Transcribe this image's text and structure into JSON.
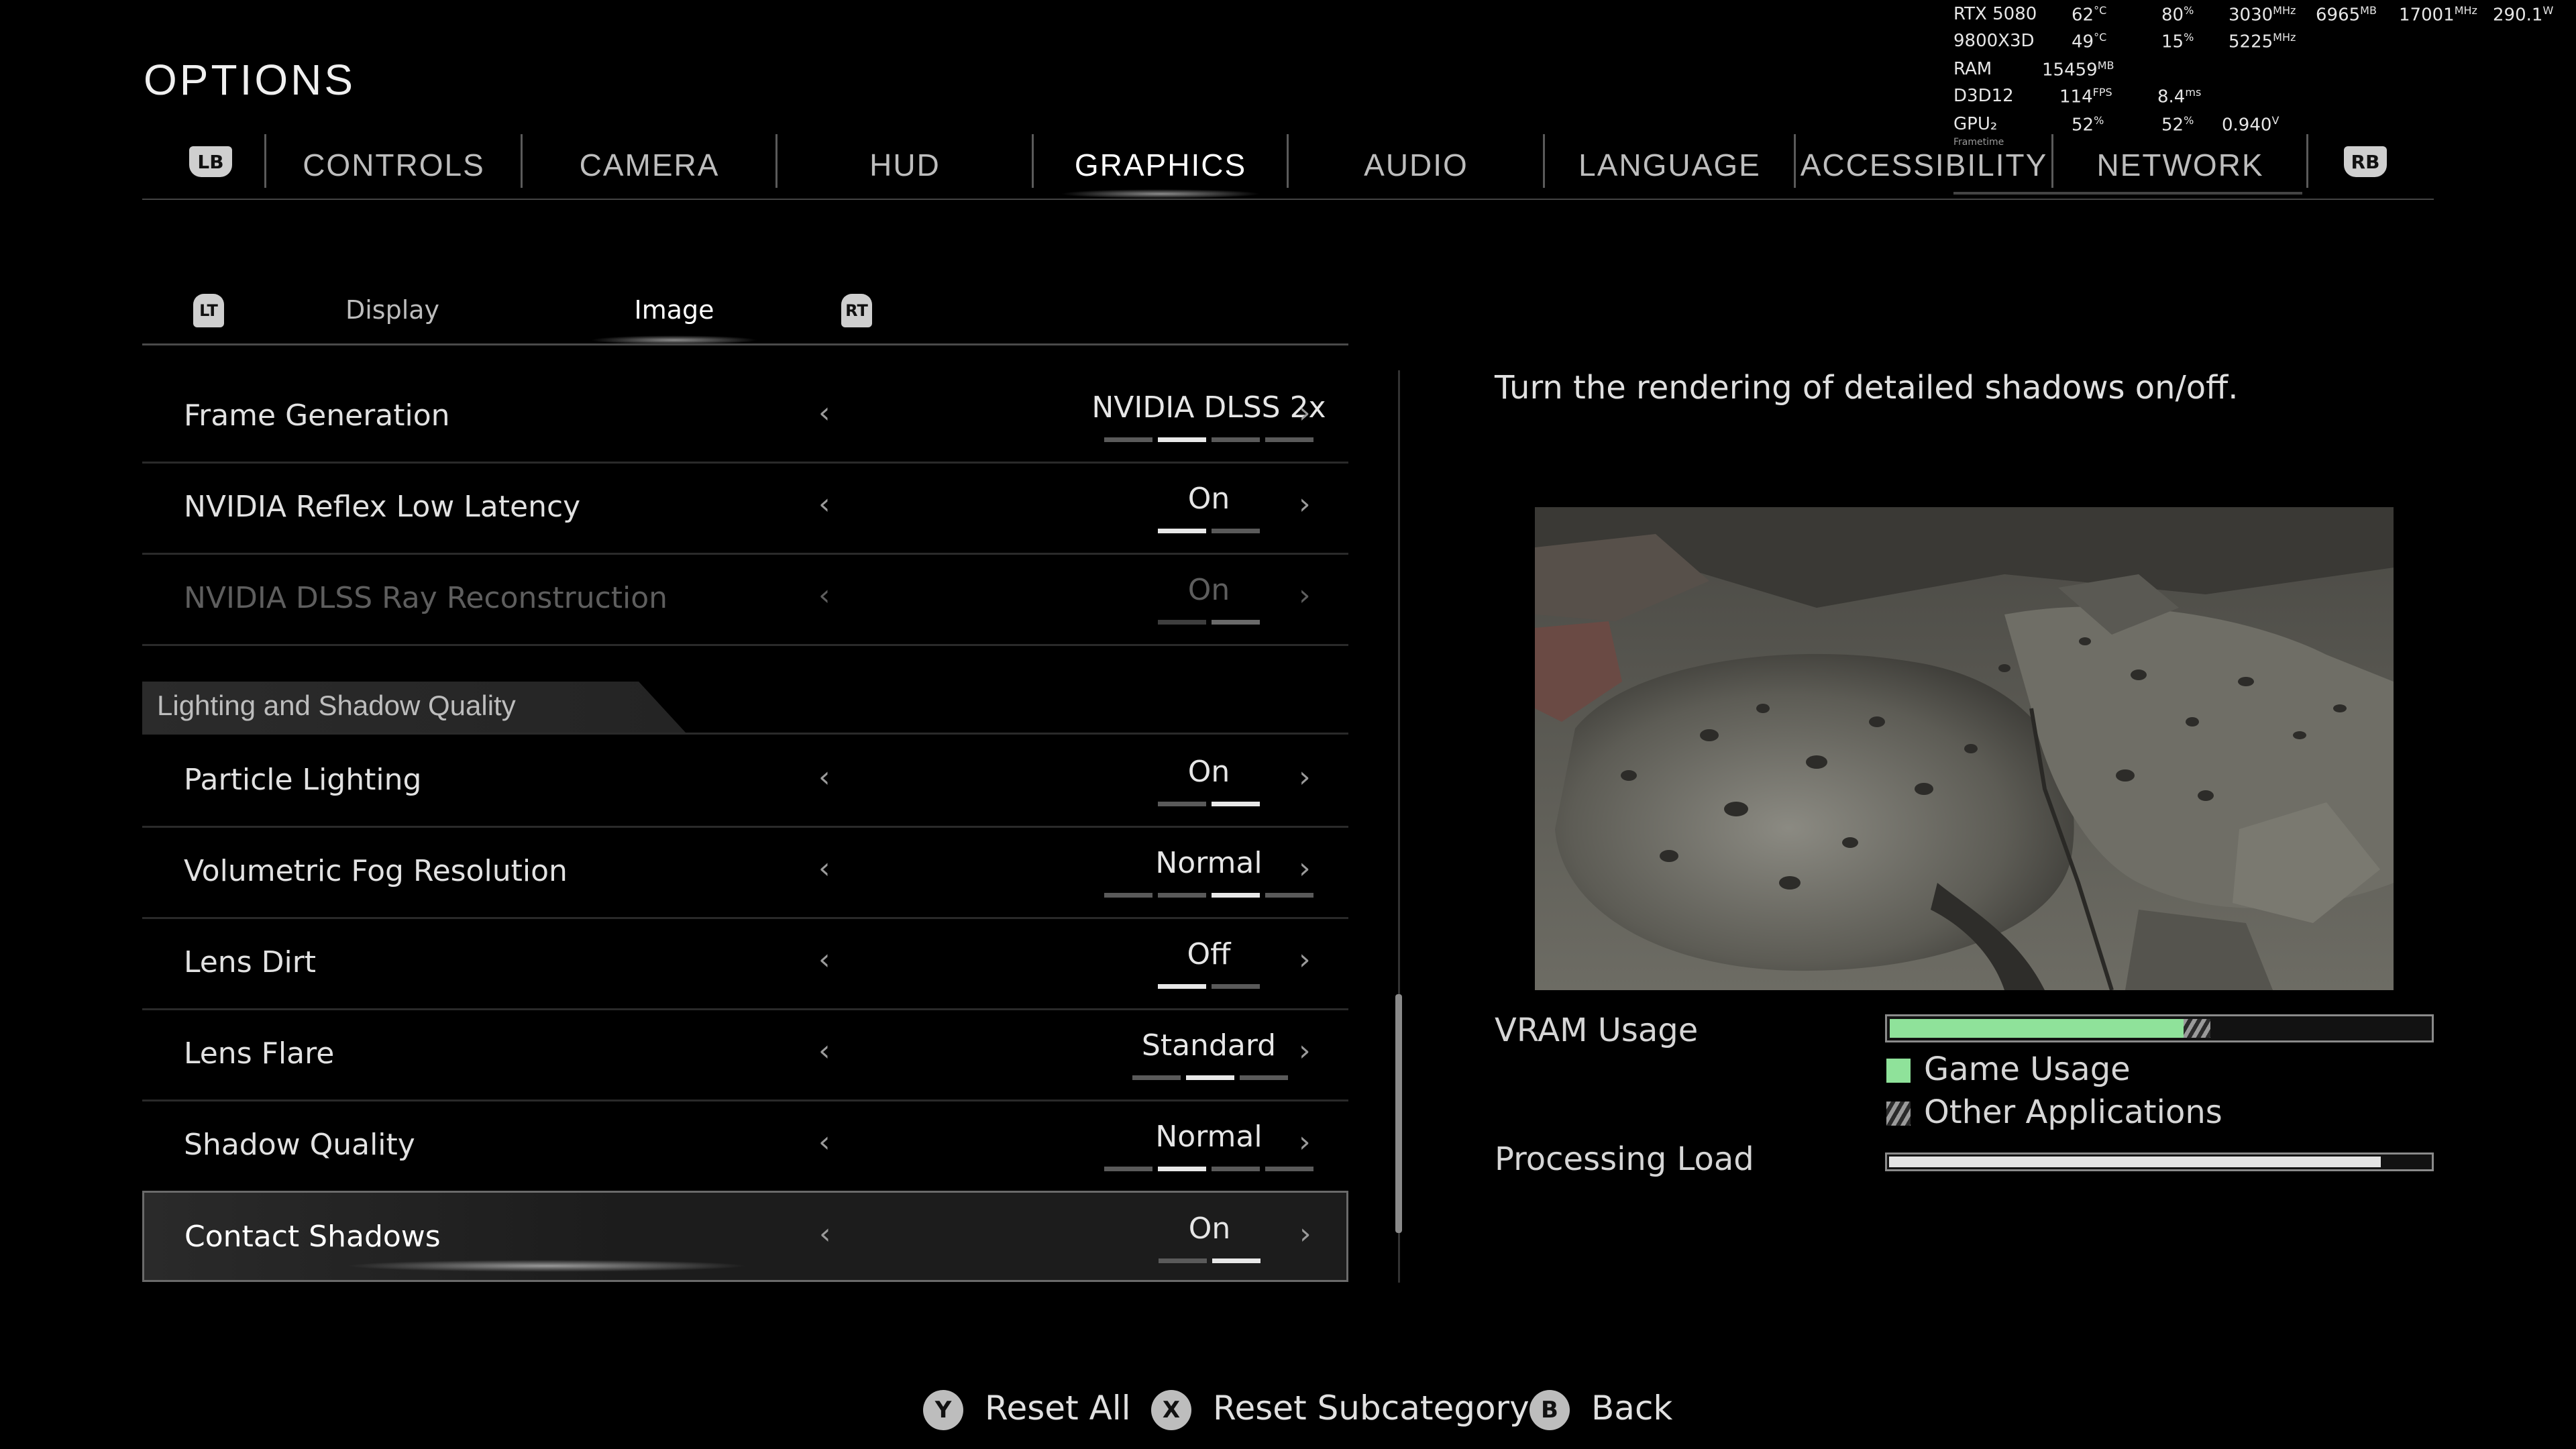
{
  "title": "OPTIONS",
  "overlay": {
    "gpu_name": "RTX 5080",
    "gpu_temp": "62",
    "gpu_temp_unit": "°C",
    "gpu_load": "80",
    "gpu_load_unit": "%",
    "gpu_clock": "3030",
    "gpu_clock_unit": "MHz",
    "vram": "6965",
    "vram_unit": "MB",
    "mem_clock": "17001",
    "mem_clock_unit": "MHz",
    "power": "290.1",
    "power_unit": "W",
    "cpu_name": "9800X3D",
    "cpu_temp": "49",
    "cpu_temp_unit": "°C",
    "cpu_load": "15",
    "cpu_load_unit": "%",
    "cpu_clock": "5225",
    "cpu_clock_unit": "MHz",
    "ram_label": "RAM",
    "ram": "15459",
    "ram_unit": "MB",
    "api_label": "D3D12",
    "fps": "114",
    "fps_unit": "FPS",
    "frametime": "8.4",
    "frametime_unit": "ms",
    "gpu2_label": "GPU₂",
    "gpu2_a": "52",
    "gpu2_a_unit": "%",
    "gpu2_b": "52",
    "gpu2_b_unit": "%",
    "voltage": "0.940",
    "voltage_unit": "V",
    "frametime_label": "Frametime"
  },
  "nav": {
    "lb": "LB",
    "rb": "RB",
    "tabs": [
      "CONTROLS",
      "CAMERA",
      "HUD",
      "GRAPHICS",
      "AUDIO",
      "LANGUAGE",
      "ACCESSIBILITY",
      "NETWORK"
    ],
    "active": "GRAPHICS"
  },
  "subnav": {
    "lt": "LT",
    "rt": "RT",
    "tabs": [
      "Display",
      "Image"
    ],
    "active": "Image"
  },
  "settings_top": [
    {
      "label": "Frame Generation",
      "value": "NVIDIA DLSS 2x",
      "segments": 4,
      "selected_index": 1,
      "enabled": true
    },
    {
      "label": "NVIDIA Reflex Low Latency",
      "value": "On",
      "segments": 2,
      "selected_index": 0,
      "enabled": true
    },
    {
      "label": "NVIDIA DLSS Ray Reconstruction",
      "value": "On",
      "segments": 2,
      "selected_index": 1,
      "enabled": false
    }
  ],
  "section_header": "Lighting and Shadow Quality",
  "settings_section": [
    {
      "label": "Particle Lighting",
      "value": "On",
      "segments": 2,
      "selected_index": 1,
      "enabled": true
    },
    {
      "label": "Volumetric Fog Resolution",
      "value": "Normal",
      "segments": 4,
      "selected_index": 2,
      "enabled": true
    },
    {
      "label": "Lens Dirt",
      "value": "Off",
      "segments": 2,
      "selected_index": 0,
      "enabled": true
    },
    {
      "label": "Lens Flare",
      "value": "Standard",
      "segments": 3,
      "selected_index": 1,
      "enabled": true
    },
    {
      "label": "Shadow Quality",
      "value": "Normal",
      "segments": 4,
      "selected_index": 1,
      "enabled": true
    },
    {
      "label": "Contact Shadows",
      "value": "On",
      "segments": 2,
      "selected_index": 1,
      "enabled": true,
      "focused": true
    }
  ],
  "description": "Turn the rendering of detailed shadows on/off.",
  "vram": {
    "label": "VRAM Usage",
    "game_fraction": 0.545,
    "other_fraction": 0.05,
    "game_legend": "Game Usage",
    "other_legend": "Other Applications",
    "game_color": "#8fe29a"
  },
  "processing": {
    "label": "Processing Load",
    "fraction": 0.91
  },
  "footer": [
    {
      "button": "Y",
      "label": "Reset All"
    },
    {
      "button": "X",
      "label": "Reset Subcategory"
    },
    {
      "button": "B",
      "label": "Back"
    }
  ]
}
